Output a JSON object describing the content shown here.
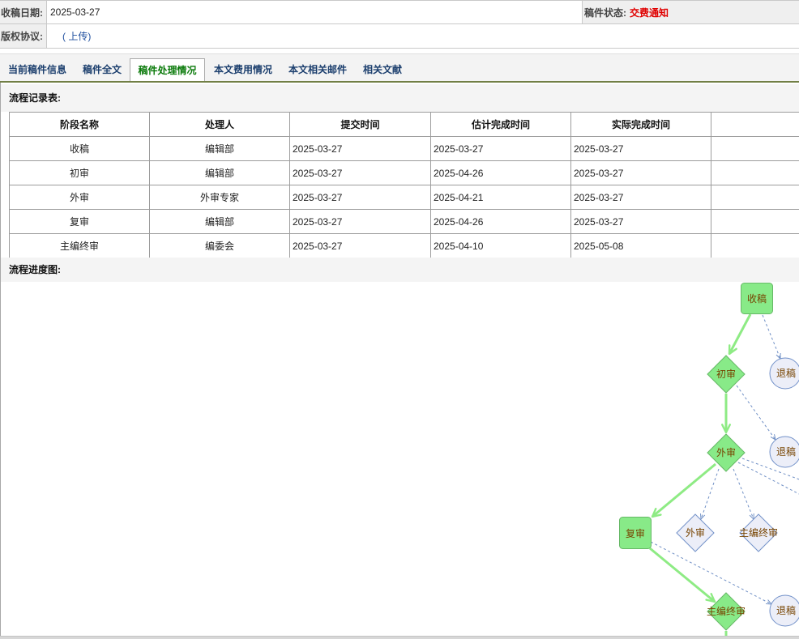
{
  "form": {
    "received_date_label": "收稿日期:",
    "received_date": "2025-03-27",
    "status_label": "稿件状态:",
    "status_value": "交费通知",
    "copyright_label": "版权协议:",
    "copyright_upload_link": "( 上传)"
  },
  "tabs": [
    {
      "label": "当前稿件信息",
      "active": false
    },
    {
      "label": "稿件全文",
      "active": false
    },
    {
      "label": "稿件处理情况",
      "active": true
    },
    {
      "label": "本文费用情况",
      "active": false
    },
    {
      "label": "本文相关邮件",
      "active": false
    },
    {
      "label": "相关文献",
      "active": false
    }
  ],
  "records": {
    "title": "流程记录表:",
    "headers": {
      "stage": "阶段名称",
      "handler": "处理人",
      "submitted": "提交时间",
      "estimated": "估计完成时间",
      "actual": "实际完成时间"
    },
    "rows": [
      {
        "stage": "收稿",
        "handler": "编辑部",
        "submitted": "2025-03-27",
        "estimated": "2025-03-27",
        "actual": "2025-03-27"
      },
      {
        "stage": "初审",
        "handler": "编辑部",
        "submitted": "2025-03-27",
        "estimated": "2025-04-26",
        "actual": "2025-03-27"
      },
      {
        "stage": "外审",
        "handler": "外审专家",
        "submitted": "2025-03-27",
        "estimated": "2025-04-21",
        "actual": "2025-03-27"
      },
      {
        "stage": "复审",
        "handler": "编辑部",
        "submitted": "2025-03-27",
        "estimated": "2025-04-26",
        "actual": "2025-03-27"
      },
      {
        "stage": "主编终审",
        "handler": "编委会",
        "submitted": "2025-03-27",
        "estimated": "2025-04-10",
        "actual": "2025-05-08"
      }
    ]
  },
  "flow": {
    "title": "流程进度图:",
    "nodes": [
      {
        "label": "收稿",
        "highlighted": true
      },
      {
        "label": "退稿",
        "highlighted": false
      },
      {
        "label": "初审",
        "highlighted": true
      },
      {
        "label": "退稿",
        "highlighted": false
      },
      {
        "label": "外审",
        "highlighted": true
      },
      {
        "label": "复审",
        "highlighted": true
      },
      {
        "label": "外审",
        "highlighted": false
      },
      {
        "label": "主编终审",
        "highlighted": false
      },
      {
        "label": "主编终审",
        "highlighted": true
      },
      {
        "label": "退稿",
        "highlighted": false
      }
    ]
  },
  "colors": {
    "status_text": "#e00000",
    "link_text": "#1f4f9f",
    "active_tab_text": "#0a7a0a",
    "tab_text": "#1c3f6e",
    "node_highlight_fill": "#88ea88",
    "node_highlight_stroke": "#66b866",
    "node_dim_fill": "#eceef8",
    "node_dim_stroke": "#7291c9",
    "edge_highlight": "#8eeb84",
    "edge_dim": "#6f8fc5",
    "node_text": "#774400"
  }
}
